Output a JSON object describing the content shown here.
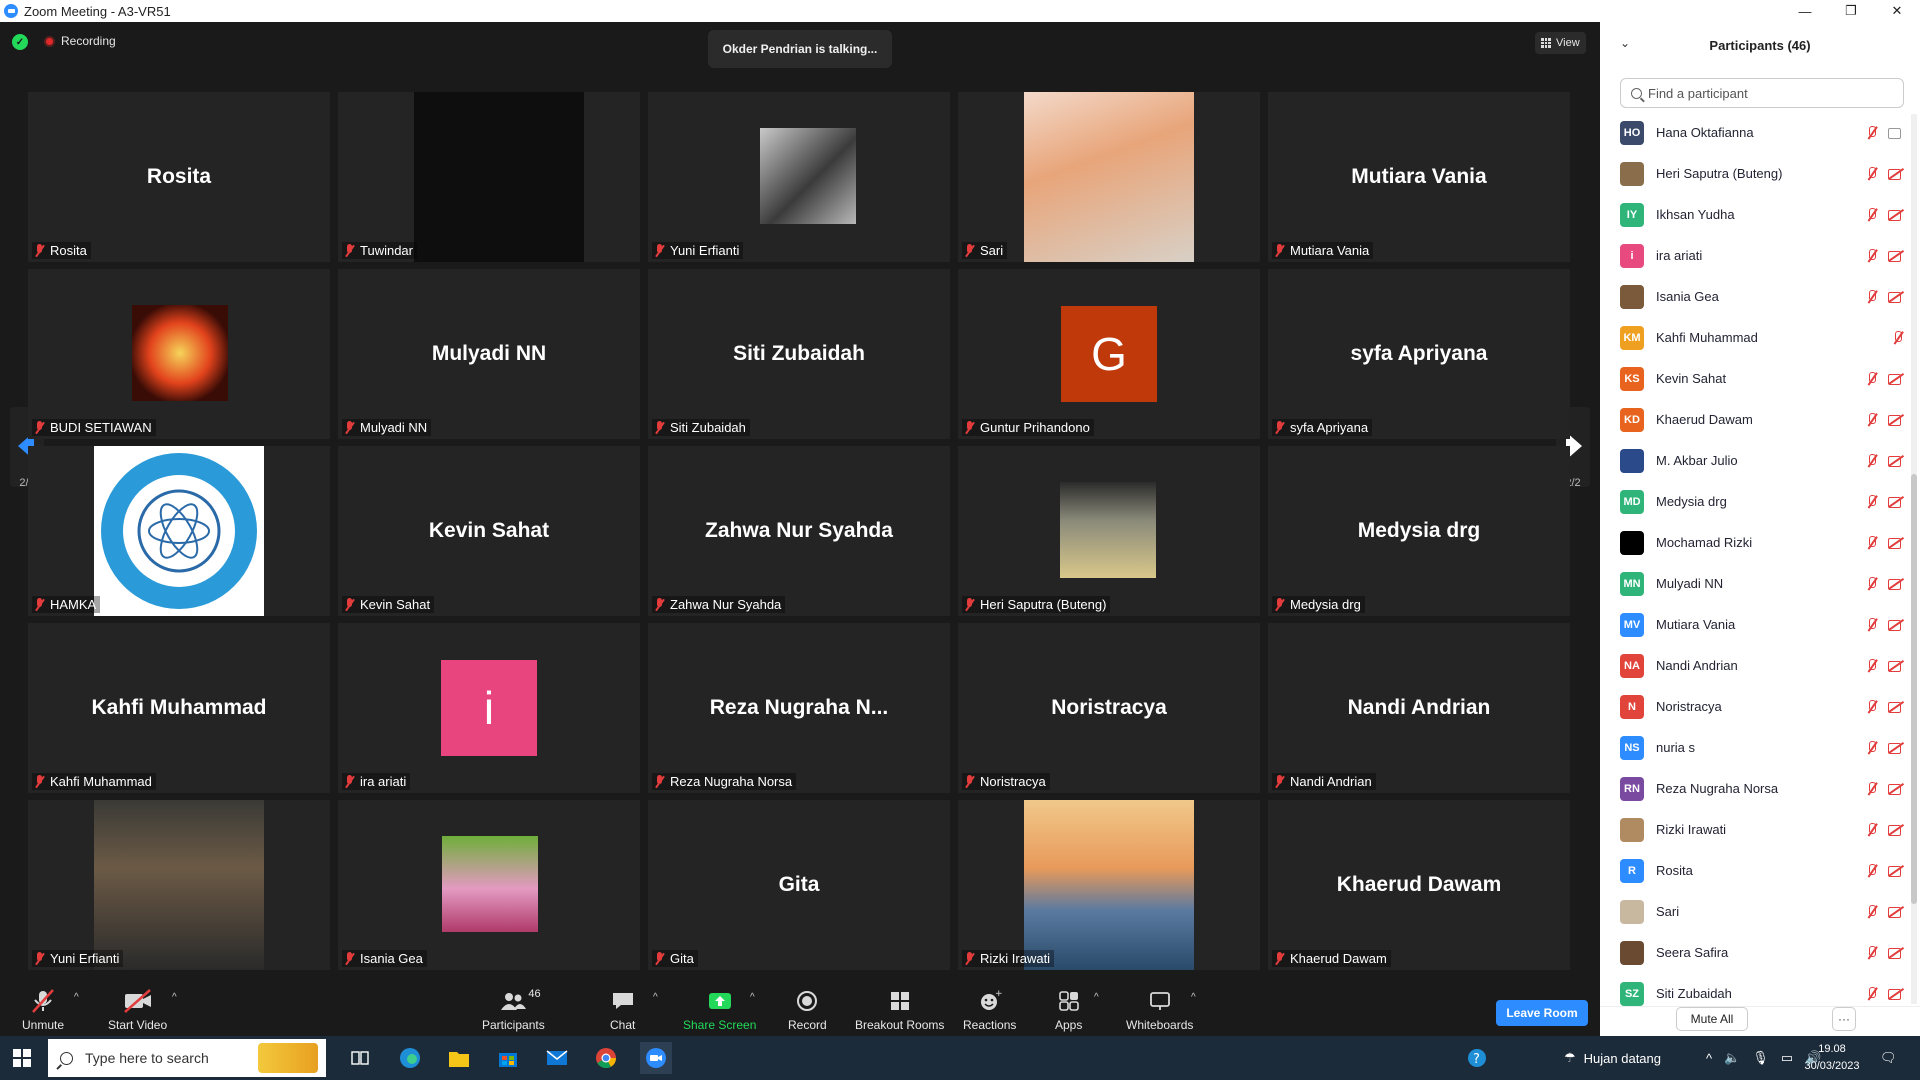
{
  "window": {
    "title": "Zoom Meeting - A3-VR51"
  },
  "topbar": {
    "recording": "Recording",
    "talking": "Okder Pendrian is talking...",
    "view": "View"
  },
  "tiles": [
    {
      "big": "Rosita",
      "label": "Rosita"
    },
    {
      "big": "",
      "label": "Tuwindar"
    },
    {
      "big": "",
      "label": "Yuni Erfianti"
    },
    {
      "big": "",
      "label": "Sari"
    },
    {
      "big": "Mutiara Vania",
      "label": "Mutiara Vania"
    },
    {
      "big": "",
      "label": "BUDI SETIAWAN"
    },
    {
      "big": "Mulyadi NN",
      "label": "Mulyadi NN"
    },
    {
      "big": "Siti Zubaidah",
      "label": "Siti Zubaidah"
    },
    {
      "big": "G",
      "label": "Guntur Prihandono"
    },
    {
      "big": "syfa Apriyana",
      "label": "syfa Apriyana"
    },
    {
      "big": "",
      "label": "HAMKA"
    },
    {
      "big": "Kevin Sahat",
      "label": "Kevin Sahat"
    },
    {
      "big": "Zahwa Nur Syahda",
      "label": "Zahwa Nur Syahda"
    },
    {
      "big": "",
      "label": "Heri Saputra (Buteng)"
    },
    {
      "big": "Medysia drg",
      "label": "Medysia drg"
    },
    {
      "big": "Kahfi Muhammad",
      "label": "Kahfi Muhammad"
    },
    {
      "big": "i",
      "label": "ira ariati"
    },
    {
      "big": "Reza Nugraha N...",
      "label": "Reza Nugraha Norsa"
    },
    {
      "big": "Noristracya",
      "label": "Noristracya"
    },
    {
      "big": "Nandi Andrian",
      "label": "Nandi Andrian"
    },
    {
      "big": "",
      "label": "Yuni Erfianti"
    },
    {
      "big": "",
      "label": "Isania Gea"
    },
    {
      "big": "Gita",
      "label": "Gita"
    },
    {
      "big": "",
      "label": "Rizki Irawati"
    },
    {
      "big": "Khaerud Dawam",
      "label": "Khaerud Dawam"
    }
  ],
  "pager": {
    "left": "2/2",
    "right": "2/2"
  },
  "toolbar": {
    "unmute": "Unmute",
    "start_video": "Start Video",
    "participants": "Participants",
    "participants_count": "46",
    "chat": "Chat",
    "share_screen": "Share Screen",
    "record": "Record",
    "breakout": "Breakout Rooms",
    "reactions": "Reactions",
    "apps": "Apps",
    "whiteboards": "Whiteboards",
    "leave": "Leave Room"
  },
  "panel": {
    "title": "Participants (46)",
    "search_placeholder": "Find a participant",
    "mute_all": "Mute All",
    "more": "···",
    "participants": [
      {
        "initials": "HO",
        "color": "#3b4a6b",
        "name": "Hana Oktafianna",
        "camera": "on"
      },
      {
        "initials": "",
        "color": "#8a6d4a",
        "name": "Heri Saputra (Buteng)",
        "camera": "off"
      },
      {
        "initials": "IY",
        "color": "#2fb57a",
        "name": "Ikhsan Yudha",
        "camera": "off"
      },
      {
        "initials": "i",
        "color": "#e84a7f",
        "name": "ira ariati",
        "camera": "off"
      },
      {
        "initials": "",
        "color": "#7a5a3a",
        "name": "Isania Gea",
        "camera": "off"
      },
      {
        "initials": "KM",
        "color": "#f0a020",
        "name": "Kahfi Muhammad",
        "camera": "none"
      },
      {
        "initials": "KS",
        "color": "#e8641e",
        "name": "Kevin Sahat",
        "camera": "off"
      },
      {
        "initials": "KD",
        "color": "#e8641e",
        "name": "Khaerud Dawam",
        "camera": "off"
      },
      {
        "initials": "",
        "color": "#2a4a8a",
        "name": "M. Akbar Julio",
        "camera": "off"
      },
      {
        "initials": "MD",
        "color": "#2fb57a",
        "name": "Medysia drg",
        "camera": "off"
      },
      {
        "initials": "",
        "color": "#000000",
        "name": "Mochamad Rizki",
        "camera": "off"
      },
      {
        "initials": "MN",
        "color": "#2fb57a",
        "name": "Mulyadi NN",
        "camera": "off"
      },
      {
        "initials": "MV",
        "color": "#2d8cff",
        "name": "Mutiara Vania",
        "camera": "off"
      },
      {
        "initials": "NA",
        "color": "#e0443a",
        "name": "Nandi Andrian",
        "camera": "off"
      },
      {
        "initials": "N",
        "color": "#e0443a",
        "name": "Noristracya",
        "camera": "off"
      },
      {
        "initials": "NS",
        "color": "#2d8cff",
        "name": "nuria s",
        "camera": "off"
      },
      {
        "initials": "RN",
        "color": "#7a4aa0",
        "name": "Reza Nugraha Norsa",
        "camera": "off"
      },
      {
        "initials": "",
        "color": "#b08a60",
        "name": "Rizki Irawati",
        "camera": "off"
      },
      {
        "initials": "R",
        "color": "#2d8cff",
        "name": "Rosita",
        "camera": "off"
      },
      {
        "initials": "",
        "color": "#c8b8a0",
        "name": "Sari",
        "camera": "off"
      },
      {
        "initials": "",
        "color": "#6a4a30",
        "name": "Seera Safira",
        "camera": "off"
      },
      {
        "initials": "SZ",
        "color": "#2fb57a",
        "name": "Siti Zubaidah",
        "camera": "off"
      }
    ]
  },
  "taskbar": {
    "search_placeholder": "Type here to search",
    "weather": "Hujan datang",
    "time": "19.08",
    "date": "30/03/2023"
  }
}
